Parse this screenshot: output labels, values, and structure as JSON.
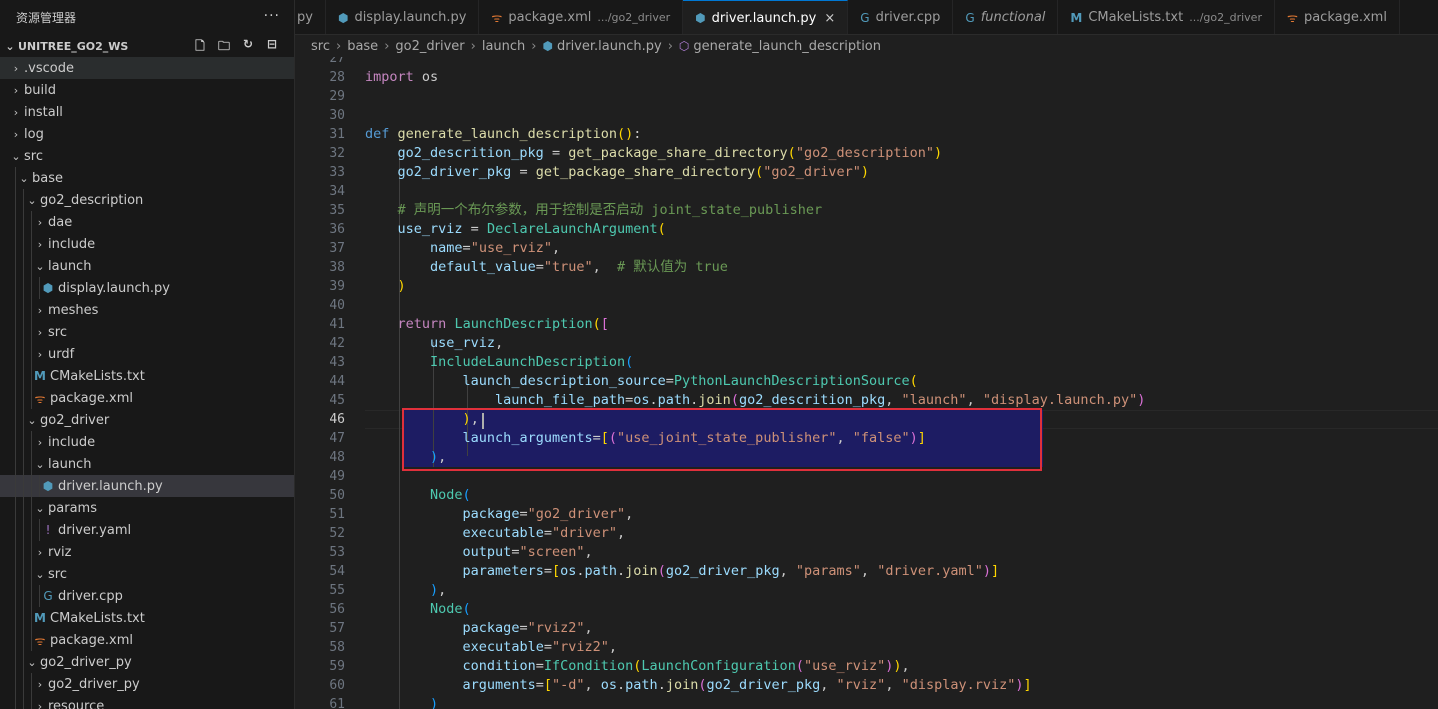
{
  "explorer": {
    "title": "资源管理器",
    "more": "···",
    "workspace": "UNITREE_GO2_WS",
    "actions": [
      "new-file-icon",
      "new-folder-icon",
      "refresh-icon",
      "collapse-icon"
    ],
    "items": [
      {
        "label": ".vscode",
        "depth": 0,
        "kind": "folder",
        "open": false,
        "state": "hover"
      },
      {
        "label": "build",
        "depth": 0,
        "kind": "folder",
        "open": false
      },
      {
        "label": "install",
        "depth": 0,
        "kind": "folder",
        "open": false
      },
      {
        "label": "log",
        "depth": 0,
        "kind": "folder",
        "open": false
      },
      {
        "label": "src",
        "depth": 0,
        "kind": "folder",
        "open": true
      },
      {
        "label": "base",
        "depth": 1,
        "kind": "folder",
        "open": true
      },
      {
        "label": "go2_description",
        "depth": 2,
        "kind": "folder",
        "open": true
      },
      {
        "label": "dae",
        "depth": 3,
        "kind": "folder",
        "open": false
      },
      {
        "label": "include",
        "depth": 3,
        "kind": "folder",
        "open": false
      },
      {
        "label": "launch",
        "depth": 3,
        "kind": "folder",
        "open": true
      },
      {
        "label": "display.launch.py",
        "depth": 4,
        "kind": "python"
      },
      {
        "label": "meshes",
        "depth": 3,
        "kind": "folder",
        "open": false
      },
      {
        "label": "src",
        "depth": 3,
        "kind": "folder",
        "open": false
      },
      {
        "label": "urdf",
        "depth": 3,
        "kind": "folder",
        "open": false
      },
      {
        "label": "CMakeLists.txt",
        "depth": 3,
        "kind": "cmake"
      },
      {
        "label": "package.xml",
        "depth": 3,
        "kind": "xml"
      },
      {
        "label": "go2_driver",
        "depth": 2,
        "kind": "folder",
        "open": true
      },
      {
        "label": "include",
        "depth": 3,
        "kind": "folder",
        "open": false
      },
      {
        "label": "launch",
        "depth": 3,
        "kind": "folder",
        "open": true
      },
      {
        "label": "driver.launch.py",
        "depth": 4,
        "kind": "python",
        "state": "selected"
      },
      {
        "label": "params",
        "depth": 3,
        "kind": "folder",
        "open": true
      },
      {
        "label": "driver.yaml",
        "depth": 4,
        "kind": "yaml"
      },
      {
        "label": "rviz",
        "depth": 3,
        "kind": "folder",
        "open": false
      },
      {
        "label": "src",
        "depth": 3,
        "kind": "folder",
        "open": true
      },
      {
        "label": "driver.cpp",
        "depth": 4,
        "kind": "cpp"
      },
      {
        "label": "CMakeLists.txt",
        "depth": 3,
        "kind": "cmake"
      },
      {
        "label": "package.xml",
        "depth": 3,
        "kind": "xml"
      },
      {
        "label": "go2_driver_py",
        "depth": 2,
        "kind": "folder",
        "open": true
      },
      {
        "label": "go2_driver_py",
        "depth": 3,
        "kind": "folder",
        "open": false
      },
      {
        "label": "resource",
        "depth": 3,
        "kind": "folder",
        "open": false
      }
    ]
  },
  "tabs": [
    {
      "label": "py",
      "icon": "",
      "desc": "",
      "active": false
    },
    {
      "label": "display.launch.py",
      "icon": "python",
      "desc": "",
      "active": false
    },
    {
      "label": "package.xml",
      "icon": "xml",
      "desc": ".../go2_driver",
      "active": false
    },
    {
      "label": "driver.launch.py",
      "icon": "python",
      "desc": "",
      "active": true,
      "close": "×"
    },
    {
      "label": "driver.cpp",
      "icon": "cpp",
      "desc": "",
      "active": false
    },
    {
      "label": "functional",
      "icon": "cpp",
      "desc": "",
      "active": false,
      "italic": true
    },
    {
      "label": "CMakeLists.txt",
      "icon": "cmake",
      "desc": ".../go2_driver",
      "active": false
    },
    {
      "label": "package.xml",
      "icon": "xml",
      "desc": "",
      "active": false
    }
  ],
  "breadcrumb": [
    "src",
    "base",
    "go2_driver",
    "launch",
    "driver.launch.py",
    "generate_launch_description"
  ],
  "editor": {
    "first_line": 27,
    "current_line": 46,
    "lines": [
      [],
      [
        [
          "kc",
          "import"
        ],
        [
          "p",
          " os"
        ]
      ],
      [],
      [],
      [
        [
          "kw",
          "def"
        ],
        [
          "p",
          " "
        ],
        [
          "fn",
          "generate_launch_description"
        ],
        [
          "br1",
          "()"
        ],
        [
          "p",
          ":"
        ]
      ],
      [
        [
          "p",
          "    "
        ],
        [
          "var",
          "go2_descrition_pkg"
        ],
        [
          "p",
          " = "
        ],
        [
          "fn",
          "get_package_share_directory"
        ],
        [
          "br1",
          "("
        ],
        [
          "str",
          "\"go2_description\""
        ],
        [
          "br1",
          ")"
        ]
      ],
      [
        [
          "p",
          "    "
        ],
        [
          "var",
          "go2_driver_pkg"
        ],
        [
          "p",
          " = "
        ],
        [
          "fn",
          "get_package_share_directory"
        ],
        [
          "br1",
          "("
        ],
        [
          "str",
          "\"go2_driver\""
        ],
        [
          "br1",
          ")"
        ]
      ],
      [],
      [
        [
          "p",
          "    "
        ],
        [
          "cmt",
          "# 声明一个布尔参数，用于控制是否启动 joint_state_publisher"
        ]
      ],
      [
        [
          "p",
          "    "
        ],
        [
          "var",
          "use_rviz"
        ],
        [
          "p",
          " = "
        ],
        [
          "cls",
          "DeclareLaunchArgument"
        ],
        [
          "br1",
          "("
        ]
      ],
      [
        [
          "p",
          "        "
        ],
        [
          "var",
          "name"
        ],
        [
          "p",
          "="
        ],
        [
          "str",
          "\"use_rviz\""
        ],
        [
          "p",
          ","
        ]
      ],
      [
        [
          "p",
          "        "
        ],
        [
          "var",
          "default_value"
        ],
        [
          "p",
          "="
        ],
        [
          "str",
          "\"true\""
        ],
        [
          "p",
          ",  "
        ],
        [
          "cmt",
          "# 默认值为 true"
        ]
      ],
      [
        [
          "p",
          "    "
        ],
        [
          "br1",
          ")"
        ]
      ],
      [],
      [
        [
          "p",
          "    "
        ],
        [
          "kc",
          "return"
        ],
        [
          "p",
          " "
        ],
        [
          "cls",
          "LaunchDescription"
        ],
        [
          "br1",
          "("
        ],
        [
          "br2",
          "["
        ]
      ],
      [
        [
          "p",
          "        "
        ],
        [
          "var",
          "use_rviz"
        ],
        [
          "p",
          ","
        ]
      ],
      [
        [
          "p",
          "        "
        ],
        [
          "cls",
          "IncludeLaunchDescription"
        ],
        [
          "br3",
          "("
        ]
      ],
      [
        [
          "p",
          "            "
        ],
        [
          "var",
          "launch_description_source"
        ],
        [
          "p",
          "="
        ],
        [
          "cls",
          "PythonLaunchDescriptionSource"
        ],
        [
          "br1",
          "("
        ]
      ],
      [
        [
          "p",
          "                "
        ],
        [
          "var",
          "launch_file_path"
        ],
        [
          "p",
          "="
        ],
        [
          "var",
          "os"
        ],
        [
          "p",
          "."
        ],
        [
          "var",
          "path"
        ],
        [
          "p",
          "."
        ],
        [
          "fn",
          "join"
        ],
        [
          "br2",
          "("
        ],
        [
          "var",
          "go2_descrition_pkg"
        ],
        [
          "p",
          ", "
        ],
        [
          "str",
          "\"launch\""
        ],
        [
          "p",
          ", "
        ],
        [
          "str",
          "\"display.launch.py\""
        ],
        [
          "br2",
          ")"
        ]
      ],
      [
        [
          "p",
          "            "
        ],
        [
          "br1",
          ")"
        ],
        [
          "p",
          ","
        ]
      ],
      [
        [
          "p",
          "            "
        ],
        [
          "var",
          "launch_arguments"
        ],
        [
          "p",
          "="
        ],
        [
          "br1",
          "["
        ],
        [
          "br2",
          "("
        ],
        [
          "str",
          "\"use_joint_state_publisher\""
        ],
        [
          "p",
          ", "
        ],
        [
          "str",
          "\"false\""
        ],
        [
          "br2",
          ")"
        ],
        [
          "br1",
          "]"
        ]
      ],
      [
        [
          "p",
          "        "
        ],
        [
          "br3",
          ")"
        ],
        [
          "p",
          ","
        ]
      ],
      [],
      [
        [
          "p",
          "        "
        ],
        [
          "cls",
          "Node"
        ],
        [
          "br3",
          "("
        ]
      ],
      [
        [
          "p",
          "            "
        ],
        [
          "var",
          "package"
        ],
        [
          "p",
          "="
        ],
        [
          "str",
          "\"go2_driver\""
        ],
        [
          "p",
          ","
        ]
      ],
      [
        [
          "p",
          "            "
        ],
        [
          "var",
          "executable"
        ],
        [
          "p",
          "="
        ],
        [
          "str",
          "\"driver\""
        ],
        [
          "p",
          ","
        ]
      ],
      [
        [
          "p",
          "            "
        ],
        [
          "var",
          "output"
        ],
        [
          "p",
          "="
        ],
        [
          "str",
          "\"screen\""
        ],
        [
          "p",
          ","
        ]
      ],
      [
        [
          "p",
          "            "
        ],
        [
          "var",
          "parameters"
        ],
        [
          "p",
          "="
        ],
        [
          "br1",
          "["
        ],
        [
          "var",
          "os"
        ],
        [
          "p",
          "."
        ],
        [
          "var",
          "path"
        ],
        [
          "p",
          "."
        ],
        [
          "fn",
          "join"
        ],
        [
          "br2",
          "("
        ],
        [
          "var",
          "go2_driver_pkg"
        ],
        [
          "p",
          ", "
        ],
        [
          "str",
          "\"params\""
        ],
        [
          "p",
          ", "
        ],
        [
          "str",
          "\"driver.yaml\""
        ],
        [
          "br2",
          ")"
        ],
        [
          "br1",
          "]"
        ]
      ],
      [
        [
          "p",
          "        "
        ],
        [
          "br3",
          ")"
        ],
        [
          "p",
          ","
        ]
      ],
      [
        [
          "p",
          "        "
        ],
        [
          "cls",
          "Node"
        ],
        [
          "br3",
          "("
        ]
      ],
      [
        [
          "p",
          "            "
        ],
        [
          "var",
          "package"
        ],
        [
          "p",
          "="
        ],
        [
          "str",
          "\"rviz2\""
        ],
        [
          "p",
          ","
        ]
      ],
      [
        [
          "p",
          "            "
        ],
        [
          "var",
          "executable"
        ],
        [
          "p",
          "="
        ],
        [
          "str",
          "\"rviz2\""
        ],
        [
          "p",
          ","
        ]
      ],
      [
        [
          "p",
          "            "
        ],
        [
          "var",
          "condition"
        ],
        [
          "p",
          "="
        ],
        [
          "cls",
          "IfCondition"
        ],
        [
          "br1",
          "("
        ],
        [
          "cls",
          "LaunchConfiguration"
        ],
        [
          "br2",
          "("
        ],
        [
          "str",
          "\"use_rviz\""
        ],
        [
          "br2",
          ")"
        ],
        [
          "br1",
          ")"
        ],
        [
          "p",
          ","
        ]
      ],
      [
        [
          "p",
          "            "
        ],
        [
          "var",
          "arguments"
        ],
        [
          "p",
          "="
        ],
        [
          "br1",
          "["
        ],
        [
          "str",
          "\"-d\""
        ],
        [
          "p",
          ", "
        ],
        [
          "var",
          "os"
        ],
        [
          "p",
          "."
        ],
        [
          "var",
          "path"
        ],
        [
          "p",
          "."
        ],
        [
          "fn",
          "join"
        ],
        [
          "br2",
          "("
        ],
        [
          "var",
          "go2_driver_pkg"
        ],
        [
          "p",
          ", "
        ],
        [
          "str",
          "\"rviz\""
        ],
        [
          "p",
          ", "
        ],
        [
          "str",
          "\"display.rviz\""
        ],
        [
          "br2",
          ")"
        ],
        [
          "br1",
          "]"
        ]
      ],
      [
        [
          "p",
          "        "
        ],
        [
          "br3",
          ")"
        ]
      ]
    ]
  },
  "colors": {
    "accent": "#0078d4",
    "highlight_box": "#e0303b",
    "selection": "#1d1c63",
    "python_icon": "#519aba",
    "xml_icon": "#e37933",
    "cmake_icon": "#519aba",
    "cpp_icon": "#519aba",
    "yaml_icon": "#a074c4"
  }
}
